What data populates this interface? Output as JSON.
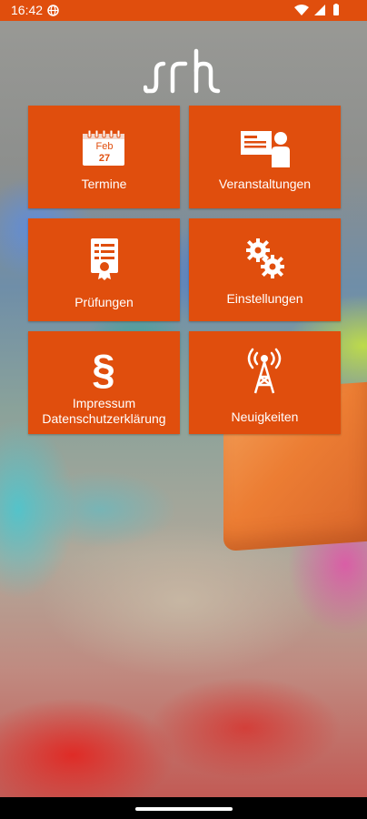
{
  "status_bar": {
    "time": "16:42",
    "icons": [
      "globe-icon",
      "wifi-icon",
      "signal-icon",
      "battery-icon"
    ]
  },
  "brand": {
    "logo_text": "srh",
    "accent_color": "#e04e0d"
  },
  "calendar_icon": {
    "month": "Feb",
    "day": "27"
  },
  "tiles": [
    {
      "label": "Termine",
      "icon": "calendar-icon"
    },
    {
      "label": "Veranstaltungen",
      "icon": "presentation-icon"
    },
    {
      "label": "Prüfungen",
      "icon": "certificate-icon"
    },
    {
      "label": "Einstellungen",
      "icon": "gears-icon"
    },
    {
      "label_line1": "Impressum",
      "label_line2": "Datenschutzerklärung",
      "icon": "paragraph-icon"
    },
    {
      "label": "Neuigkeiten",
      "icon": "antenna-icon"
    }
  ]
}
